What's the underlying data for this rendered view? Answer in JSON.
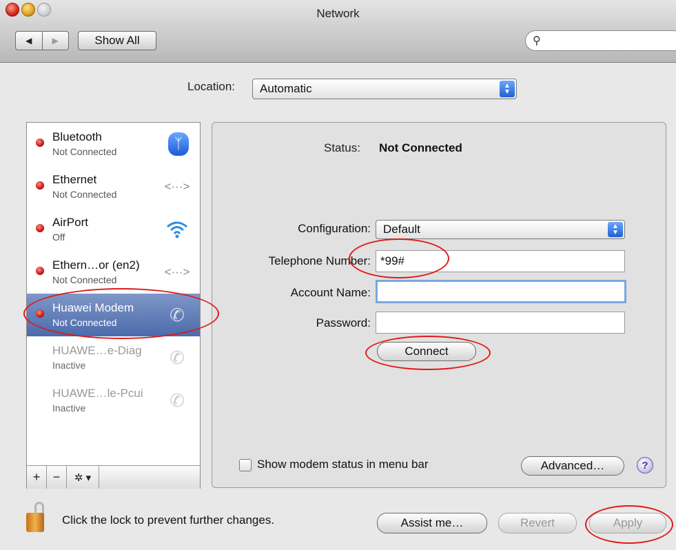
{
  "window": {
    "title": "Network"
  },
  "toolbar": {
    "back_icon": "◀",
    "forward_icon": "▶",
    "show_all": "Show All",
    "search_icon": "🔍",
    "search_value": ""
  },
  "location": {
    "label": "Location:",
    "value": "Automatic"
  },
  "services": [
    {
      "name": "Bluetooth",
      "state": "Not Connected",
      "icon": "bluetooth-icon"
    },
    {
      "name": "Ethernet",
      "state": "Not Connected",
      "icon": "ethernet-icon"
    },
    {
      "name": "AirPort",
      "state": "Off",
      "icon": "wifi-icon"
    },
    {
      "name": "Ethern…or (en2)",
      "state": "Not Connected",
      "icon": "ethernet-icon"
    },
    {
      "name": "Huawei Modem",
      "state": "Not Connected",
      "icon": "phone-icon",
      "selected": true
    },
    {
      "name": "HUAWE…e-Diag",
      "state": "Inactive",
      "icon": "phone-icon"
    },
    {
      "name": "HUAWE…le-Pcui",
      "state": "Inactive",
      "icon": "phone-icon"
    }
  ],
  "sidebar_tools": {
    "add": "+",
    "remove": "−",
    "gear": "✲ ▾"
  },
  "detail": {
    "status_label": "Status:",
    "status_value": "Not Connected",
    "configuration_label": "Configuration:",
    "configuration_value": "Default",
    "telephone_label": "Telephone Number:",
    "telephone_value": "*99#",
    "account_label": "Account Name:",
    "account_value": "",
    "password_label": "Password:",
    "password_value": "",
    "connect": "Connect",
    "show_modem_status": "Show modem status in menu bar",
    "advanced": "Advanced…",
    "help": "?"
  },
  "footer": {
    "lock_text": "Click the lock to prevent further changes.",
    "assist": "Assist me…",
    "revert": "Revert",
    "apply": "Apply"
  },
  "colors": {
    "selection": "#4c6bab",
    "annotation": "#e01818",
    "status_dot": "#c01010"
  }
}
